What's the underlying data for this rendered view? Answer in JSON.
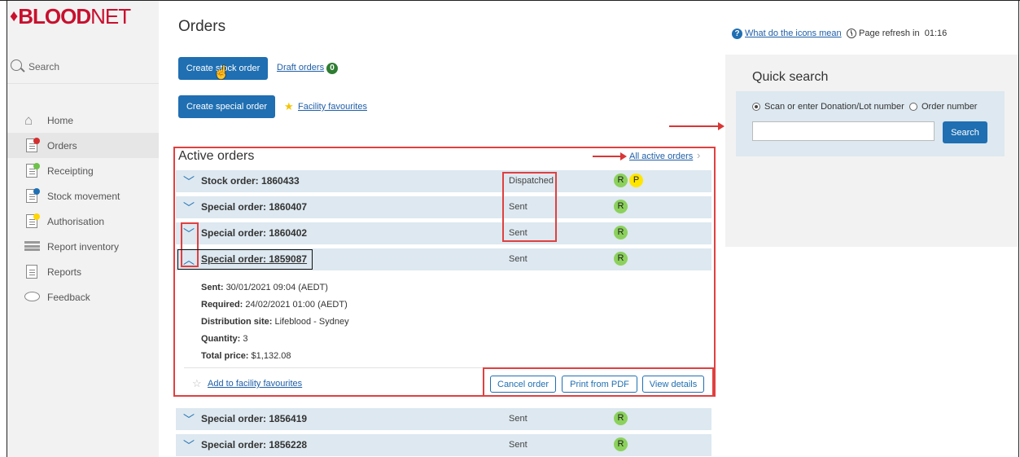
{
  "brand": {
    "logo_bold": "BLOOD",
    "logo_thin": "NET",
    "accent_color": "#c8102e"
  },
  "sidebar": {
    "search_label": "Search",
    "items": [
      {
        "label": "Home",
        "icon": "home-icon"
      },
      {
        "label": "Orders",
        "icon": "orders-icon",
        "active": true
      },
      {
        "label": "Receipting",
        "icon": "receipting-icon"
      },
      {
        "label": "Stock movement",
        "icon": "stock-movement-icon"
      },
      {
        "label": "Authorisation",
        "icon": "authorisation-icon"
      },
      {
        "label": "Report inventory",
        "icon": "report-inventory-icon"
      },
      {
        "label": "Reports",
        "icon": "reports-icon"
      },
      {
        "label": "Feedback",
        "icon": "feedback-icon"
      }
    ]
  },
  "main": {
    "title": "Orders",
    "create_stock_label": "Create stock order",
    "draft_orders_label": "Draft orders",
    "draft_orders_count": "0",
    "create_special_label": "Create special order",
    "facility_favourites_label": "Facility favourites",
    "active_orders_title": "Active orders",
    "all_active_label": "All active orders",
    "orders": [
      {
        "label": "Stock order: 1860433",
        "status": "Dispatched",
        "badges": [
          "R",
          "P"
        ],
        "expanded": false
      },
      {
        "label": "Special order: 1860407",
        "status": "Sent",
        "badges": [
          "R"
        ],
        "expanded": false
      },
      {
        "label": "Special order: 1860402",
        "status": "Sent",
        "badges": [
          "R"
        ],
        "expanded": false
      },
      {
        "label": "Special order: 1859087",
        "status": "Sent",
        "badges": [
          "R"
        ],
        "expanded": true
      },
      {
        "label": "Special order: 1856419",
        "status": "Sent",
        "badges": [
          "R"
        ],
        "expanded": false
      },
      {
        "label": "Special order: 1856228",
        "status": "Sent",
        "badges": [
          "R"
        ],
        "expanded": false
      }
    ],
    "expanded_details": {
      "sent_label": "Sent:",
      "sent_value": "30/01/2021 09:04 (AEDT)",
      "required_label": "Required:",
      "required_value": "24/02/2021 01:00 (AEDT)",
      "site_label": "Distribution site:",
      "site_value": "Lifeblood - Sydney",
      "quantity_label": "Quantity:",
      "quantity_value": "3",
      "price_label": "Total price:",
      "price_value": "$1,132.08"
    },
    "add_favourites_label": "Add to facility favourites",
    "cancel_label": "Cancel order",
    "print_label": "Print from PDF",
    "view_label": "View details"
  },
  "right": {
    "help_label": "What do the icons mean",
    "refresh_label": "Page refresh in",
    "refresh_time": "01:16",
    "quick_search_title": "Quick search",
    "radio_scan_label": "Scan or enter Donation/Lot number",
    "radio_order_label": "Order number",
    "search_button": "Search"
  }
}
